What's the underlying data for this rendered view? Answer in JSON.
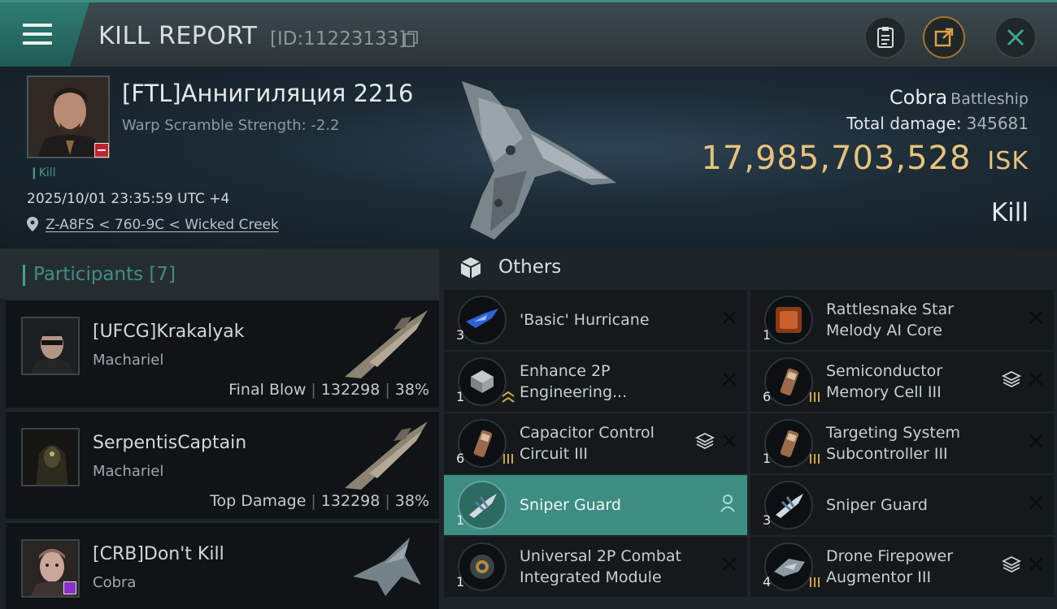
{
  "header": {
    "title": "KILL REPORT",
    "report_id": "[ID:11223133]"
  },
  "victim": {
    "name": "[FTL]Аннигиляция 2216",
    "warp_scramble": "Warp Scramble Strength: -2.2",
    "kill_tag": "Kill",
    "datetime": "2025/10/01 23:35:59 UTC +4",
    "location": "Z-A8FS < 760-9C < Wicked Creek",
    "ship_name": "Cobra",
    "ship_class": "Battleship",
    "total_damage_label": "Total damage:",
    "total_damage": "345681",
    "isk_value": "17,985,703,528",
    "isk_unit": "ISK",
    "result": "Kill"
  },
  "participants": {
    "title": "Participants",
    "count": "[7]",
    "rows": [
      {
        "name": "[UFCG]Krakalyak",
        "ship": "Machariel",
        "role": "Final Blow",
        "damage": "132298",
        "percent": "38%"
      },
      {
        "name": "SerpentisCaptain",
        "ship": "Machariel",
        "role": "Top Damage",
        "damage": "132298",
        "percent": "38%"
      },
      {
        "name": "[CRB]Don't Kill",
        "ship": "Cobra",
        "role": "",
        "damage": "",
        "percent": ""
      }
    ]
  },
  "others": {
    "title": "Others",
    "items": [
      {
        "qty": "3",
        "line1": "'Basic' Hurricane",
        "line2": ""
      },
      {
        "qty": "1",
        "line1": "Rattlesnake Star",
        "line2": "Melody AI Core"
      },
      {
        "qty": "1",
        "line1": "Enhance 2P",
        "line2": "Engineering..."
      },
      {
        "qty": "6",
        "line1": "Semiconductor",
        "line2": "Memory Cell III"
      },
      {
        "qty": "6",
        "line1": "Capacitor Control",
        "line2": "Circuit III"
      },
      {
        "qty": "1",
        "line1": "Targeting System",
        "line2": "Subcontroller III"
      },
      {
        "qty": "1",
        "line1": "Sniper  Guard",
        "line2": ""
      },
      {
        "qty": "3",
        "line1": "Sniper  Guard",
        "line2": ""
      },
      {
        "qty": "1",
        "line1": "Universal 2P Combat",
        "line2": "Integrated Module"
      },
      {
        "qty": "4",
        "line1": "Drone Firepower",
        "line2": "Augmentor III"
      }
    ]
  },
  "colors": {
    "accent": "#3f8f86",
    "isk": "#e8c27a",
    "selected_row": "#3d8d82",
    "badge_red": "#c0232b"
  }
}
